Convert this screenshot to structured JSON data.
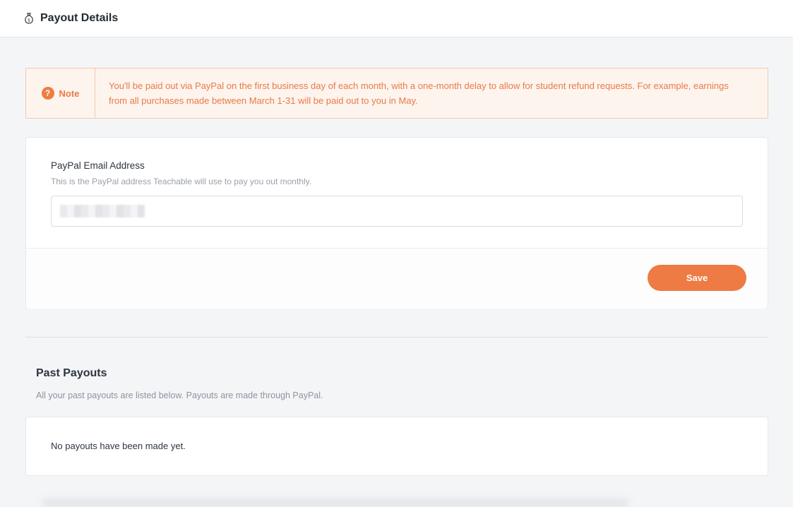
{
  "header": {
    "icon": "money-bag-icon",
    "title": "Payout Details"
  },
  "note": {
    "icon": "question-circle-icon",
    "label": "Note",
    "text": "You'll be paid out via PayPal on the first business day of each month, with a one-month delay to allow for student refund requests. For example, earnings from all purchases made between March 1-31 will be paid out to you in May."
  },
  "paypal_form": {
    "label": "PayPal Email Address",
    "help": "This is the PayPal address Teachable will use to pay you out monthly.",
    "value": "",
    "save_label": "Save"
  },
  "past_payouts": {
    "title": "Past Payouts",
    "subtitle": "All your past payouts are listed below. Payouts are made through PayPal.",
    "empty_text": "No payouts have been made yet."
  },
  "colors": {
    "accent": "#ee7a44",
    "note_bg": "#fdf4ee",
    "note_border": "#f3c9ab"
  }
}
